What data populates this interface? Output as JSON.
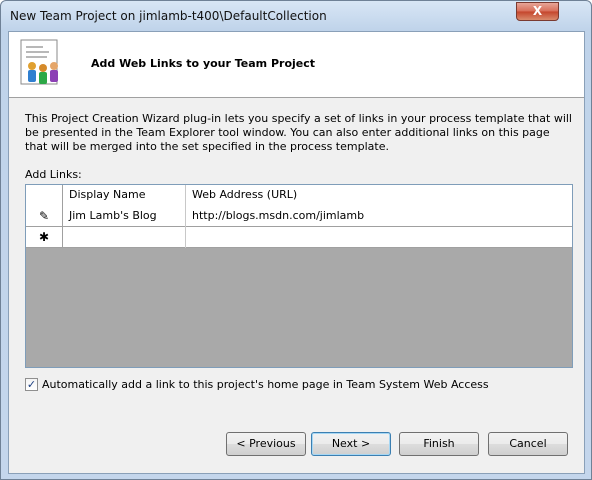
{
  "window": {
    "title": "New Team Project on jimlamb-t400\\DefaultCollection",
    "close_glyph": "X"
  },
  "header": {
    "title": "Add Web Links to your Team Project",
    "icon": "team-document-icon"
  },
  "intro_text": "This Project Creation Wizard plug-in lets you specify a set of links in your process template that will be presented in the Team Explorer tool window. You can also enter additional links on this page that will be merged into the set specified in the process template.",
  "links": {
    "label": "Add Links:",
    "columns": [
      "Display Name",
      "Web Address (URL)"
    ],
    "rows": [
      {
        "marker": "✎",
        "display_name": "Jim Lamb's Blog",
        "url": "http://blogs.msdn.com/jimlamb"
      },
      {
        "marker": "✱",
        "display_name": "",
        "url": ""
      }
    ]
  },
  "auto_link": {
    "checked": true,
    "check_glyph": "✓",
    "label": "Automatically add a link to this project's home page in Team System Web Access"
  },
  "buttons": {
    "previous": "< Previous",
    "next": "Next >",
    "finish": "Finish",
    "cancel": "Cancel"
  }
}
